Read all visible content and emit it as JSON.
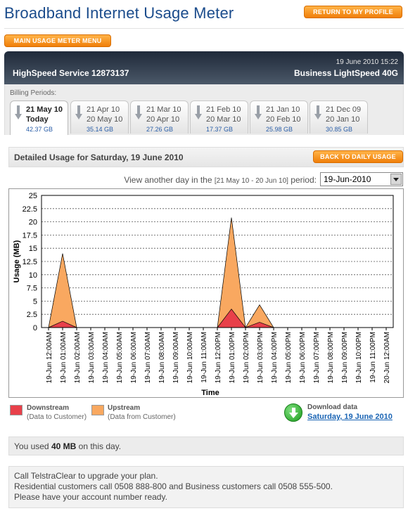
{
  "header": {
    "title": "Broadband Internet Usage Meter",
    "return_label": "RETURN TO MY PROFILE",
    "menu_label": "MAIN USAGE METER MENU"
  },
  "service": {
    "datetime": "19 June 2010 15:22",
    "name": "HighSpeed Service 12873137",
    "plan": "Business LightSpeed 40G"
  },
  "billing": {
    "label": "Billing Periods:",
    "periods": [
      {
        "from": "21 May 10",
        "to": "Today",
        "usage": "42.37 GB",
        "active": true
      },
      {
        "from": "21 Apr 10",
        "to": "20 May 10",
        "usage": "35.14 GB"
      },
      {
        "from": "21 Mar 10",
        "to": "20 Apr 10",
        "usage": "27.26 GB"
      },
      {
        "from": "21 Feb 10",
        "to": "20 Mar 10",
        "usage": "17.37 GB"
      },
      {
        "from": "21 Jan 10",
        "to": "20 Feb 10",
        "usage": "25.98 GB"
      },
      {
        "from": "21 Dec 09",
        "to": "20 Jan 10",
        "usage": "30.85 GB"
      }
    ]
  },
  "detail": {
    "title": "Detailed Usage for Saturday, 19 June 2010",
    "back_label": "BACK TO DAILY USAGE",
    "day_prefix": "View another day in the",
    "day_range": "[21 May 10 - 20 Jun 10]",
    "day_suffix": "period:",
    "selected_day": "19-Jun-2010"
  },
  "chart_data": {
    "type": "area",
    "xlabel": "Time",
    "ylabel": "Usage (MB)",
    "ylim": [
      0,
      25
    ],
    "yticks": [
      0,
      2.5,
      5,
      7.5,
      10,
      12.5,
      15,
      17.5,
      20,
      22.5,
      25
    ],
    "grid": true,
    "stacked": true,
    "categories": [
      "19-Jun 12:00AM",
      "19-Jun 01:00AM",
      "19-Jun 02:00AM",
      "19-Jun 03:00AM",
      "19-Jun 04:00AM",
      "19-Jun 05:00AM",
      "19-Jun 06:00AM",
      "19-Jun 07:00AM",
      "19-Jun 08:00AM",
      "19-Jun 09:00AM",
      "19-Jun 10:00AM",
      "19-Jun 11:00AM",
      "19-Jun 12:00PM",
      "19-Jun 01:00PM",
      "19-Jun 02:00PM",
      "19-Jun 03:00PM",
      "19-Jun 04:00PM",
      "19-Jun 05:00PM",
      "19-Jun 06:00PM",
      "19-Jun 07:00PM",
      "19-Jun 08:00PM",
      "19-Jun 09:00PM",
      "19-Jun 10:00PM",
      "19-Jun 11:00PM",
      "20-Jun 12:00AM"
    ],
    "series": [
      {
        "name": "Downstream",
        "color": "#e8404a",
        "values": [
          0,
          1.2,
          0,
          0,
          0,
          0,
          0,
          0,
          0,
          0,
          0,
          0,
          0,
          3.5,
          0,
          1.0,
          0,
          0,
          0,
          0,
          0,
          0,
          0,
          0,
          0
        ]
      },
      {
        "name": "Upstream",
        "color": "#f9a860",
        "values": [
          0,
          12.8,
          0,
          0,
          0,
          0,
          0,
          0,
          0,
          0,
          0,
          0,
          0,
          17.3,
          0,
          3.3,
          0,
          0,
          0,
          0,
          0,
          0,
          0,
          0,
          0
        ]
      }
    ]
  },
  "legend": {
    "downstream_title": "Downstream",
    "downstream_sub": "(Data to Customer)",
    "upstream_title": "Upstream",
    "upstream_sub": "(Data from Customer)",
    "download_title": "Download data",
    "download_link": "Saturday, 19 June 2010"
  },
  "summary": {
    "prefix": "You used",
    "amount": "40 MB",
    "suffix": "on this day."
  },
  "upgrade": {
    "line1": "Call TelstraClear to upgrade your plan.",
    "line2": "Residential customers call 0508 888-800 and Business customers call 0508 555-500.",
    "line3": "Please have your account number ready."
  },
  "colors": {
    "accent": "#f07f0a",
    "title": "#1b4c8c",
    "link": "#1a64b4"
  }
}
